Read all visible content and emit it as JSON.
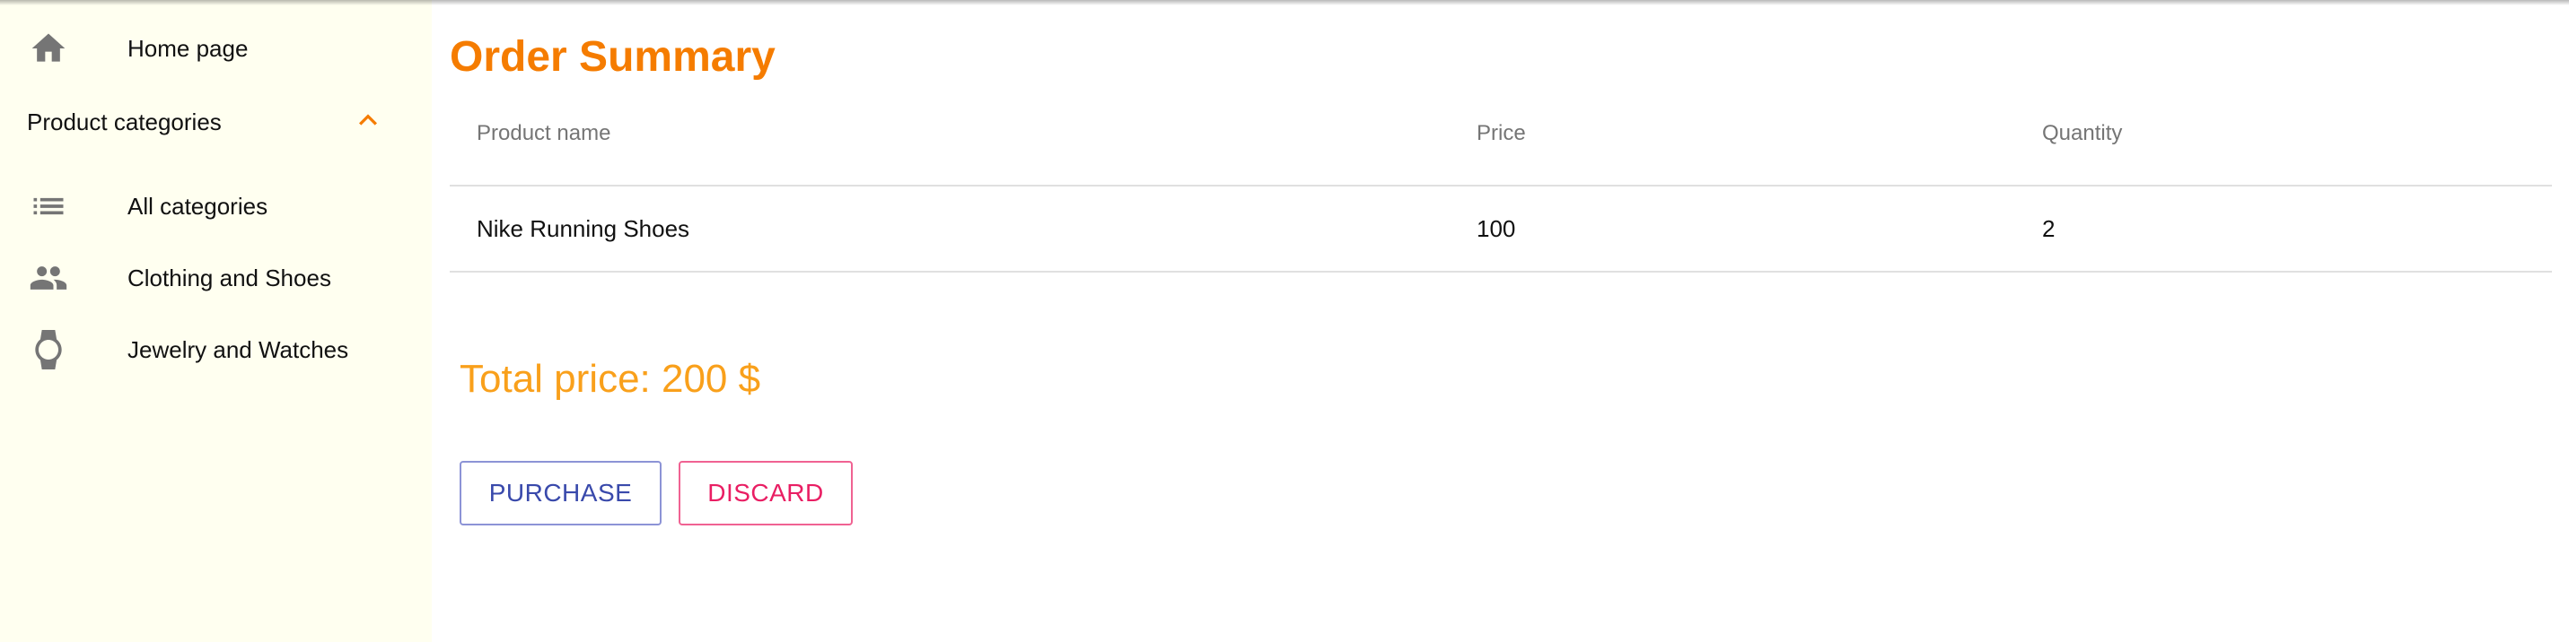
{
  "sidebar": {
    "home": {
      "label": "Home page",
      "icon": "home-icon"
    },
    "categories_header": {
      "label": "Product categories",
      "icon": "chevron-up-icon",
      "expanded": true
    },
    "items": [
      {
        "label": "All categories",
        "icon": "list-icon"
      },
      {
        "label": "Clothing and Shoes",
        "icon": "people-icon"
      },
      {
        "label": "Jewelry and Watches",
        "icon": "watch-icon"
      }
    ]
  },
  "main": {
    "title": "Order Summary",
    "table": {
      "columns": [
        "Product name",
        "Price",
        "Quantity"
      ],
      "rows": [
        [
          "Nike Running Shoes",
          "100",
          "2"
        ]
      ]
    },
    "total": "Total price: 200 $",
    "buttons": {
      "purchase": "PURCHASE",
      "discard": "DISCARD"
    }
  },
  "colors": {
    "accent": "#f57c00",
    "total": "#f9a01b",
    "sidebar_bg": "#fffff0",
    "purchase": "#3949ab",
    "discard": "#e91e63"
  }
}
